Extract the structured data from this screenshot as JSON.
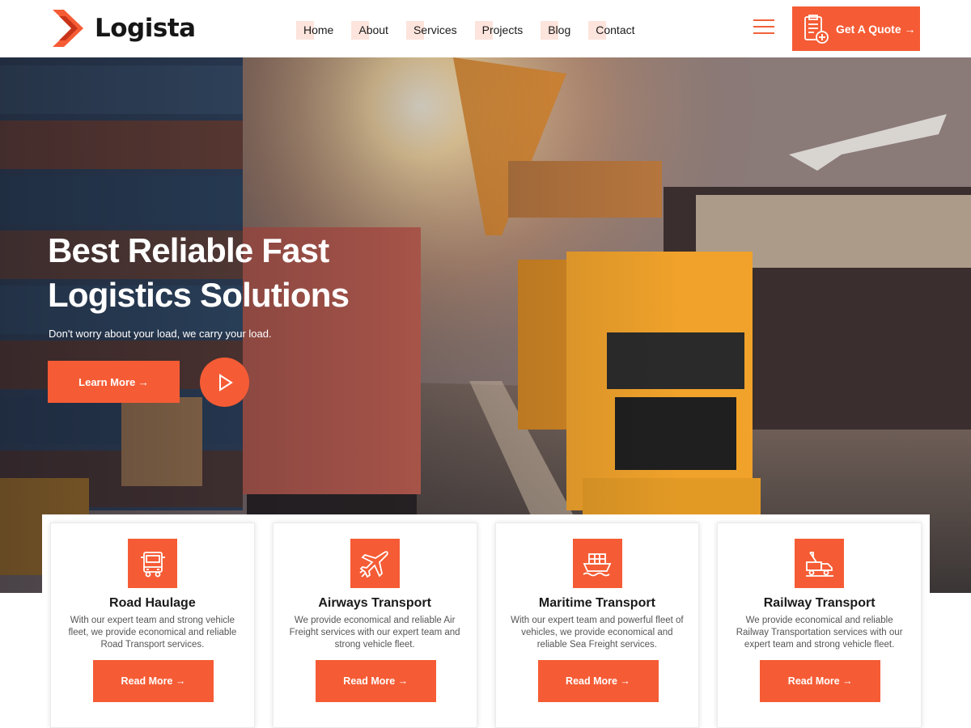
{
  "brand": {
    "name": "Logista"
  },
  "nav": {
    "items": [
      {
        "label": "Home"
      },
      {
        "label": "About"
      },
      {
        "label": "Services"
      },
      {
        "label": "Projects"
      },
      {
        "label": "Blog"
      },
      {
        "label": "Contact"
      }
    ],
    "menu_icon": "hamburger-icon",
    "quote_button": {
      "label": "Get A Quote →",
      "icon": "document-plus-icon"
    }
  },
  "hero": {
    "title": "Best Reliable Fast Logistics Solutions",
    "subtitle": "Don't worry about your load, we carry your load.",
    "cta_label": "Learn More →",
    "play_icon": "play-icon"
  },
  "services": [
    {
      "icon": "truck-icon",
      "title": "Road Haulage",
      "description": "With our expert team and strong vehicle fleet, we provide economical and reliable Road Transport services.",
      "button": "Read More →"
    },
    {
      "icon": "airplane-icon",
      "title": "Airways Transport",
      "description": "We provide economical and reliable Air Freight services with our expert team and strong vehicle fleet.",
      "button": "Read More →"
    },
    {
      "icon": "ship-icon",
      "title": "Maritime Transport",
      "description": "With our expert team and powerful fleet of vehicles, we provide economical and reliable Sea Freight services.",
      "button": "Read More →"
    },
    {
      "icon": "tow-truck-icon",
      "title": "Railway Transport",
      "description": "We provide economical and reliable Railway Transportation services with our expert team and strong vehicle fleet.",
      "button": "Read More →"
    }
  ],
  "colors": {
    "accent": "#f55c35",
    "nav_highlight": "#fde4dc",
    "text": "#1a1a1a"
  }
}
